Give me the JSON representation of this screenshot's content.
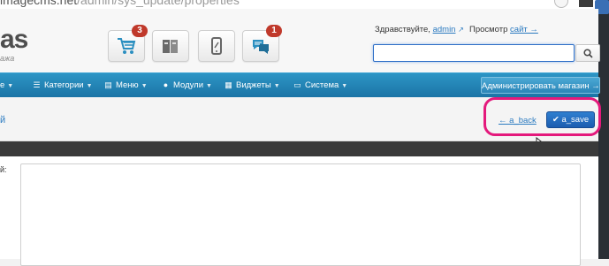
{
  "browser": {
    "url_host": "imagecms.net",
    "url_path": "/admin/sys_update/properties"
  },
  "header": {
    "logo_text": "as",
    "logo_subtitle": "ажа",
    "buttons": [
      {
        "name": "cart",
        "badge": "3"
      },
      {
        "name": "catalog",
        "badge": ""
      },
      {
        "name": "mobile",
        "badge": ""
      },
      {
        "name": "messages",
        "badge": "1"
      }
    ],
    "greeting_label": "Здравствуйте,",
    "user_link": "admin",
    "view_label": "Просмотр",
    "site_link": "сайт →",
    "search_placeholder": ""
  },
  "nav": {
    "items": [
      {
        "label": "е",
        "icon": "caret-down-icon"
      },
      {
        "label": "Категории",
        "icon": "list-icon"
      },
      {
        "label": "Меню",
        "icon": "menu-icon"
      },
      {
        "label": "Модули",
        "icon": "modules-icon"
      },
      {
        "label": "Виджеты",
        "icon": "widgets-icon"
      },
      {
        "label": "Система",
        "icon": "system-icon"
      }
    ],
    "admin_shop_button": "Администрировать магазин →"
  },
  "page": {
    "title": "й",
    "back_link": "← a_back",
    "save_label": "a_save"
  },
  "content": {
    "field_label": "й:",
    "textarea_value": ""
  },
  "colors": {
    "nav": "#1b74a6",
    "accent": "#2a7ac0",
    "save": "#1c5db0",
    "badge": "#c0392b",
    "highlight": "#e4197c"
  }
}
